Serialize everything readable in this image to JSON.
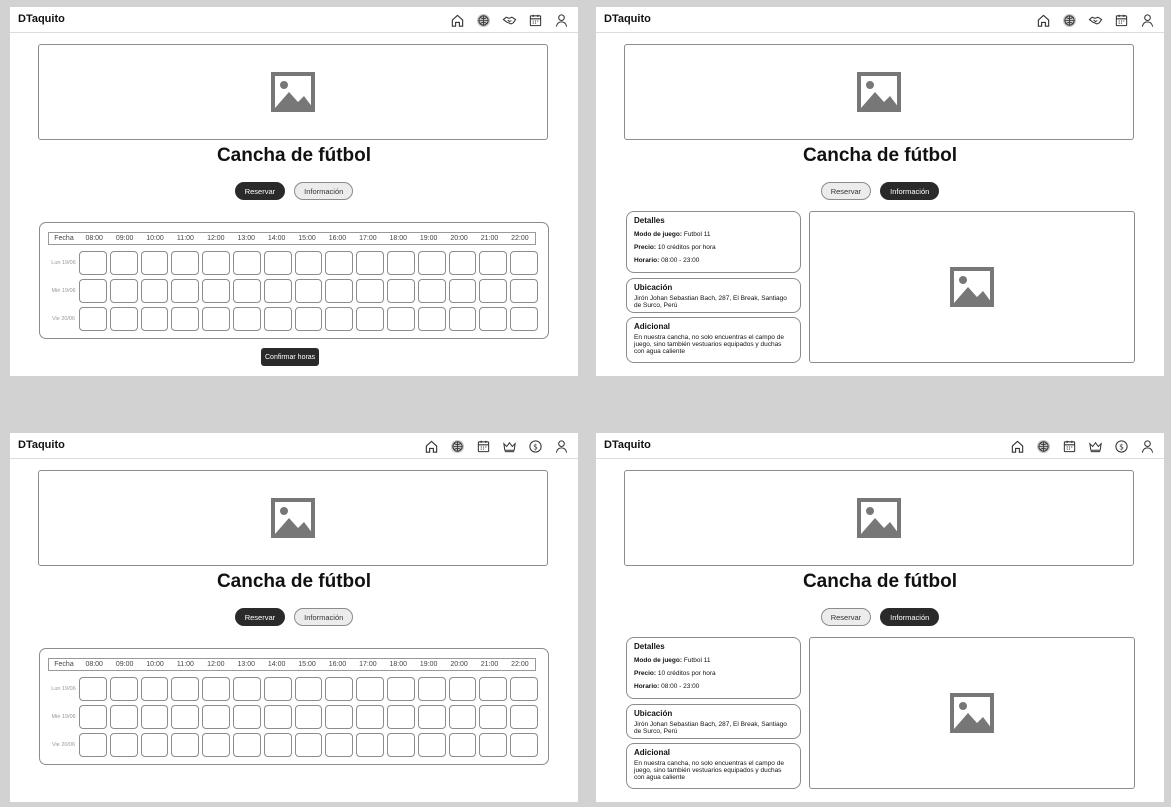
{
  "brand": "DTaquito",
  "title": "Cancha de fútbol",
  "tabs": {
    "reservar": "Reservar",
    "informacion": "Información"
  },
  "schedule": {
    "fecha_label": "Fecha",
    "hours": [
      "08:00",
      "09:00",
      "10:00",
      "11:00",
      "12:00",
      "13:00",
      "14:00",
      "15:00",
      "16:00",
      "17:00",
      "18:00",
      "19:00",
      "20:00",
      "21:00",
      "22:00"
    ],
    "rows": [
      "Lun 19/06",
      "Mié 19/06",
      "Vie 20/06"
    ]
  },
  "confirm_label": "Confirmar horas",
  "details": {
    "heading": "Detalles",
    "modo_label": "Modo de juego:",
    "modo_value": "Futbol 11",
    "precio_label": "Precio:",
    "precio_value": "10 créditos por hora",
    "horario_label": "Horario:",
    "horario_value": "08:00 - 23:00"
  },
  "location": {
    "heading": "Ubicación",
    "text": "Jirón Johan Sebastian Bach, 287, El Break, Santiago de Surco, Perú"
  },
  "extra": {
    "heading": "Adicional",
    "text": "En nuestra cancha, no solo  encuentras el campo de juego, sino también vestuarios equipados y duchas  con agua caliente"
  },
  "icons": {
    "nav_a": [
      "home-icon",
      "ball-icon",
      "handshake-icon",
      "calendar-icon",
      "user-icon"
    ],
    "nav_b": [
      "home-icon",
      "ball-icon",
      "calendar-icon",
      "crown-icon",
      "coin-icon",
      "user-icon"
    ]
  }
}
